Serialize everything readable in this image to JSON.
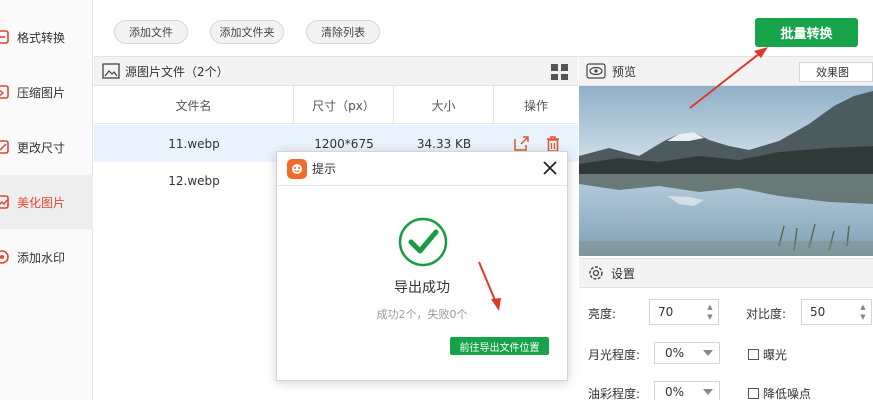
{
  "sidebar": {
    "items": [
      {
        "label": "格式转换",
        "icon": "format-convert-icon",
        "active": false
      },
      {
        "label": "压缩图片",
        "icon": "compress-image-icon",
        "active": false
      },
      {
        "label": "更改尺寸",
        "icon": "resize-icon",
        "active": false
      },
      {
        "label": "美化图片",
        "icon": "beautify-image-icon",
        "active": true
      },
      {
        "label": "添加水印",
        "icon": "watermark-icon",
        "active": false
      }
    ]
  },
  "toolbar": {
    "add_file": "添加文件",
    "add_folder": "添加文件夹",
    "clear_list": "清除列表",
    "batch_convert": "批量转换"
  },
  "file_list": {
    "title": "源图片文件（2个）",
    "columns": [
      "文件名",
      "尺寸（px）",
      "大小",
      "操作"
    ],
    "rows": [
      {
        "name": "11.webp",
        "size": "1200*675",
        "filesize": "34.33 KB",
        "selected": true
      },
      {
        "name": "12.webp",
        "size": "",
        "filesize": "",
        "selected": false
      }
    ]
  },
  "preview": {
    "label": "预览",
    "effect_option": "效果图"
  },
  "settings": {
    "label": "设置",
    "brightness_label": "亮度:",
    "brightness_value": "70",
    "contrast_label": "对比度:",
    "contrast_value": "50",
    "moonlight_label": "月光程度:",
    "moonlight_value": "0%",
    "exposure_label": "曝光",
    "oil_label": "油彩程度:",
    "oil_value": "0%",
    "denoise_label": "降低噪点"
  },
  "dialog": {
    "title": "提示",
    "message": "导出成功",
    "detail": "成功2个，失败0个",
    "go_button": "前往导出文件位置"
  },
  "colors": {
    "accent_green": "#17a34a",
    "active_red": "#e0462f",
    "arrow_red": "#d93a2b",
    "logo_orange": "#ef6b2c"
  }
}
